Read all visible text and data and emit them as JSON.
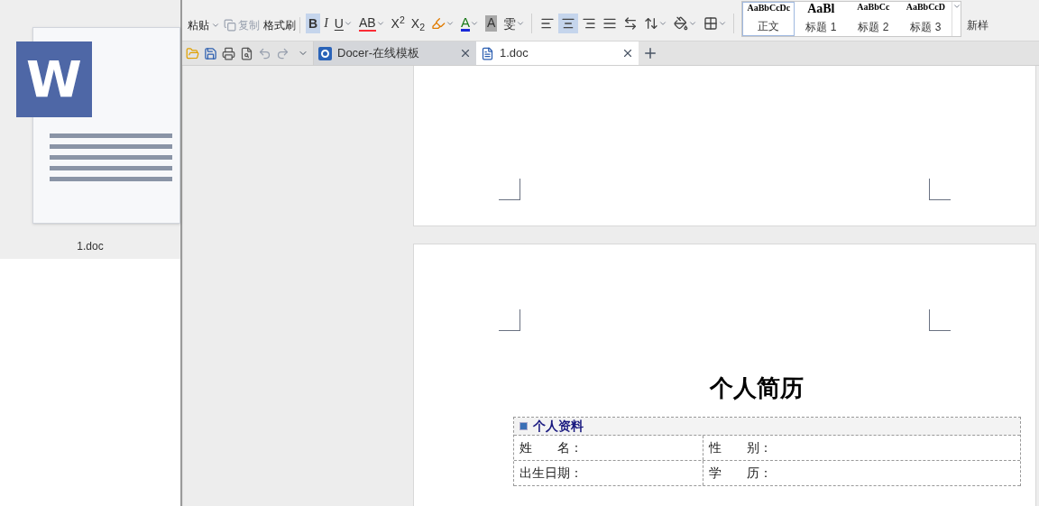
{
  "desktop": {
    "file": {
      "name": "1.doc",
      "icon_letter": "W"
    }
  },
  "ribbon": {
    "clipboard": [
      {
        "kind": "paste",
        "label": "粘贴",
        "disabled": false
      },
      {
        "kind": "copy",
        "label": "复制",
        "disabled": true
      },
      {
        "kind": "format_painter",
        "label": "格式刷",
        "disabled": false
      }
    ],
    "font_buttons": [
      {
        "kind": "bold",
        "label": "B",
        "selected": true,
        "dropdown": false
      },
      {
        "kind": "italic",
        "label": "I",
        "selected": false,
        "dropdown": false
      },
      {
        "kind": "underline",
        "label": "U",
        "selected": false,
        "dropdown": true
      },
      {
        "kind": "strike",
        "label": "AB",
        "selected": false,
        "dropdown": true
      },
      {
        "kind": "text",
        "label": "X$^{2}$",
        "selected": false,
        "dropdown": false
      },
      {
        "kind": "text",
        "label": "X$_{2}$",
        "selected": false,
        "dropdown": false
      },
      {
        "kind": "highlight",
        "selected": false,
        "dropdown": true
      },
      {
        "kind": "color",
        "label": "A",
        "selected": false,
        "dropdown": true
      },
      {
        "kind": "shade",
        "label": "A",
        "selected": false,
        "dropdown": false
      },
      {
        "kind": "text",
        "label": "雯",
        "selected": false,
        "dropdown": true
      }
    ],
    "paragraph_buttons": [
      {
        "kind": "left",
        "selected": false
      },
      {
        "kind": "center",
        "selected": true
      },
      {
        "kind": "right",
        "selected": false
      },
      {
        "kind": "justify",
        "selected": false
      },
      {
        "kind": "distributed",
        "selected": false
      },
      {
        "kind": "spacing",
        "selected": false
      },
      {
        "kind": "shading",
        "selected": false
      },
      {
        "kind": "border",
        "selected": false
      }
    ],
    "styles": [
      {
        "preview": "AaBbCcDc",
        "label": "正文",
        "selected": true
      },
      {
        "preview": "AaBl",
        "label": "标题 1",
        "selected": false
      },
      {
        "preview": "AaBbCc",
        "label": "标题 2",
        "selected": false
      },
      {
        "preview": "AaBbCcD",
        "label": "标题 3",
        "selected": false
      }
    ],
    "more_style": "新样"
  },
  "quick_access": [
    {
      "kind": "open",
      "disabled": false
    },
    {
      "kind": "save",
      "disabled": false
    },
    {
      "kind": "print",
      "disabled": false
    },
    {
      "kind": "preview",
      "disabled": false
    },
    {
      "kind": "undo",
      "disabled": true
    },
    {
      "kind": "redo",
      "disabled": true
    }
  ],
  "tabs": [
    {
      "kind": "docer",
      "label": "Docer-在线模板",
      "selected": false
    },
    {
      "kind": "doc",
      "label": "1.doc",
      "selected": true
    }
  ],
  "document": {
    "title": "个人简历",
    "section": "个人资料",
    "rows": [
      [
        "姓　　名：",
        "性　　别："
      ],
      [
        "出生日期：",
        "学　　历："
      ]
    ]
  }
}
